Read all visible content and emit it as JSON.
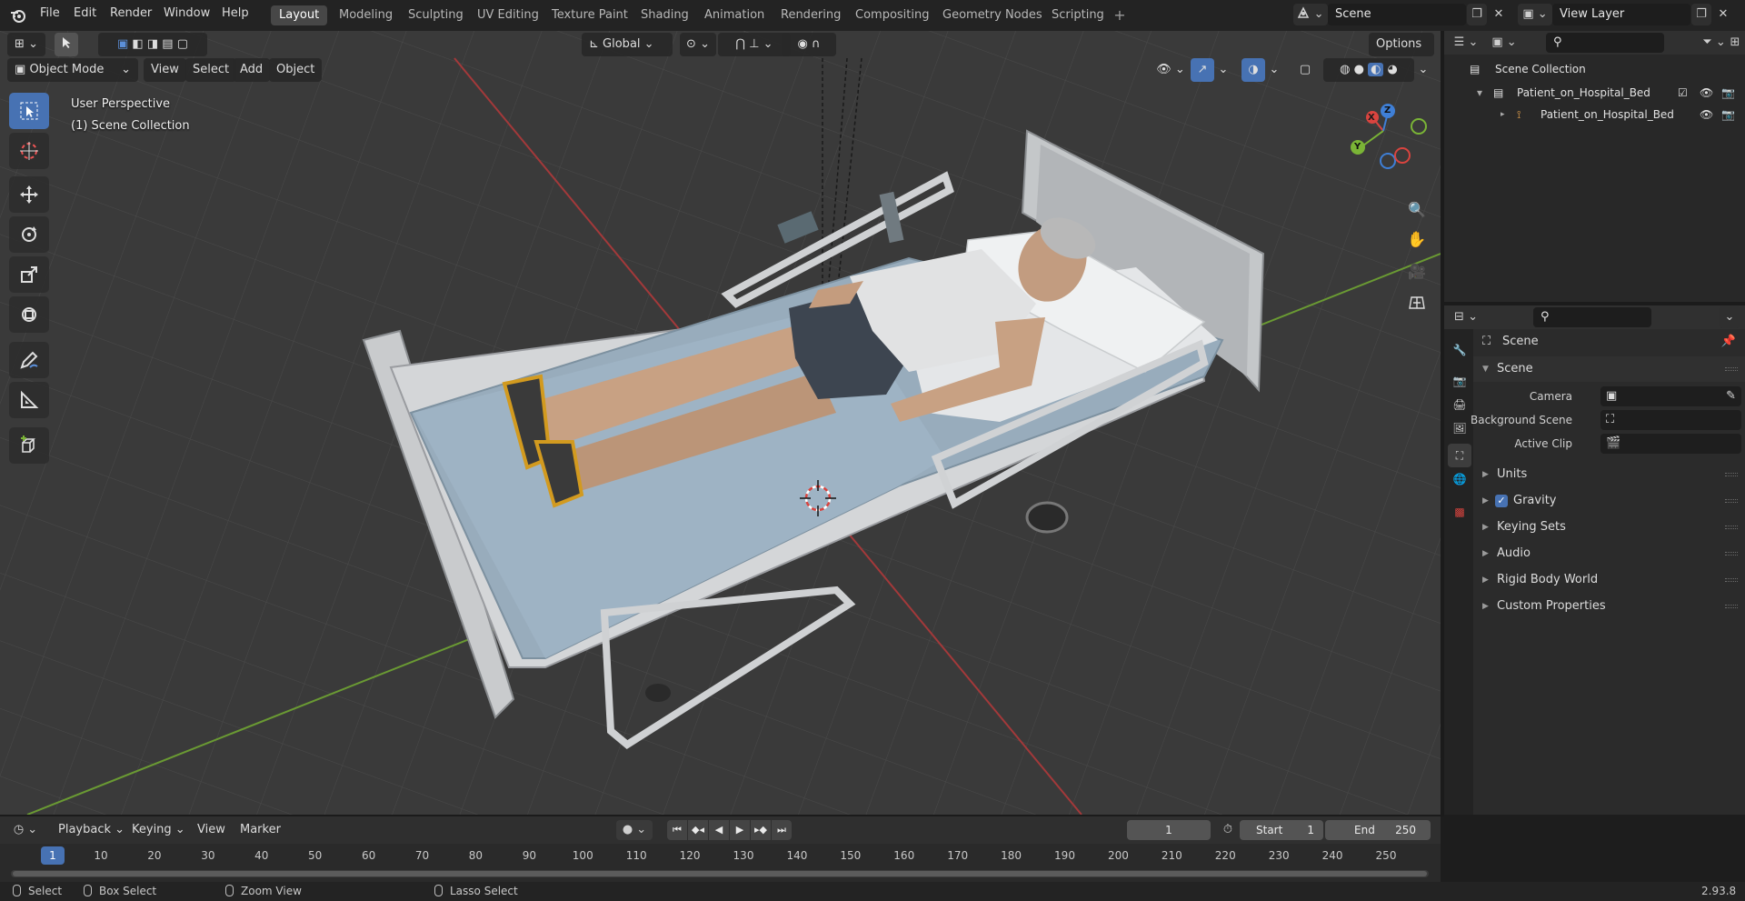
{
  "topbar": {
    "menus": [
      "File",
      "Edit",
      "Render",
      "Window",
      "Help"
    ],
    "workspaces": [
      {
        "label": "Layout",
        "active": true
      },
      {
        "label": "Modeling"
      },
      {
        "label": "Sculpting"
      },
      {
        "label": "UV Editing"
      },
      {
        "label": "Texture Paint"
      },
      {
        "label": "Shading"
      },
      {
        "label": "Animation"
      },
      {
        "label": "Rendering"
      },
      {
        "label": "Compositing"
      },
      {
        "label": "Geometry Nodes"
      },
      {
        "label": "Scripting"
      }
    ],
    "add_workspace": "+",
    "scene_name": "Scene",
    "view_layer": "View Layer"
  },
  "viewport": {
    "header": {
      "mode": "Object Mode",
      "menus": [
        "View",
        "Select",
        "Add",
        "Object"
      ],
      "transform_orientation": "Global",
      "options": "Options"
    },
    "overlay_text": {
      "perspective": "User Perspective",
      "collection": "(1) Scene Collection"
    },
    "gizmo": {
      "x": "X",
      "y": "Y",
      "z": "Z"
    },
    "colors": {
      "x_axis": "#d9443f",
      "y_axis": "#7ab436",
      "z_axis": "#3f7fd6",
      "active_tool": "#4772b3"
    }
  },
  "outliner": {
    "root": "Scene Collection",
    "items": [
      {
        "label": "Patient_on_Hospital_Bed",
        "type": "collection"
      },
      {
        "label": "Patient_on_Hospital_Bed",
        "type": "object"
      }
    ]
  },
  "properties": {
    "context": "Scene",
    "section": "Scene",
    "fields": [
      {
        "label": "Camera"
      },
      {
        "label": "Background Scene"
      },
      {
        "label": "Active Clip"
      }
    ],
    "panels": [
      "Units",
      "Gravity",
      "Keying Sets",
      "Audio",
      "Rigid Body World",
      "Custom Properties"
    ]
  },
  "timeline": {
    "menus": [
      "Playback",
      "Keying",
      "View",
      "Marker"
    ],
    "current_frame": "1",
    "start_label": "Start",
    "start": "1",
    "end_label": "End",
    "end": "250",
    "ticks": [
      "1",
      "10",
      "20",
      "30",
      "40",
      "50",
      "60",
      "70",
      "80",
      "90",
      "100",
      "110",
      "120",
      "130",
      "140",
      "150",
      "160",
      "170",
      "180",
      "190",
      "200",
      "210",
      "220",
      "230",
      "240",
      "250"
    ]
  },
  "statusbar": {
    "select": "Select",
    "box_select": "Box Select",
    "zoom_view": "Zoom View",
    "lasso_select": "Lasso Select",
    "version": "2.93.8"
  }
}
